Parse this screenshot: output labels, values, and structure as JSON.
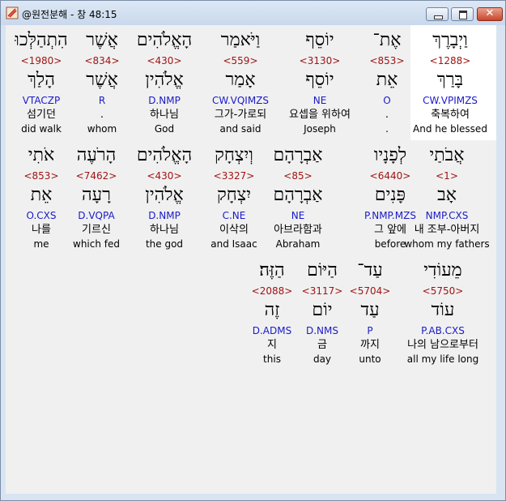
{
  "window": {
    "title": "@원전분해 - 창 48:15",
    "icons": {
      "app": "app-icon",
      "minimize": "minimize-icon",
      "maximize": "maximize-icon",
      "close": "close-icon"
    },
    "close_glyph": "✕"
  },
  "rows": [
    {
      "words": [
        {
          "heb": "וַיְבָרֶךְ",
          "strong": "<1288>",
          "lex": "בָּרַךְ",
          "morph": "CW.VPIMZS",
          "kor": "축복하여",
          "eng": "And he blessed"
        },
        {
          "heb": "אֶת־",
          "strong": "<853>",
          "lex": "אֵת",
          "morph": "O",
          "kor": ".",
          "eng": "."
        },
        {
          "heb": "יוֹסֵף",
          "strong": "<3130>",
          "lex": "יוֹסֵף",
          "morph": "NE",
          "kor": "요셉을 위하여",
          "eng": "Joseph"
        },
        {
          "heb": "וַיֹּאמַר",
          "strong": "<559>",
          "lex": "אָמַר",
          "morph": "CW.VQIMZS",
          "kor": "그가-가로되",
          "eng": "and said"
        },
        {
          "heb": "הָאֱלֹהִים",
          "strong": "<430>",
          "lex": "אֱלֹהִין",
          "morph": "D.NMP",
          "kor": "하나님",
          "eng": "God"
        },
        {
          "heb": "אֲשֶׁר",
          "strong": "<834>",
          "lex": "אֲשֶׁר",
          "morph": "R",
          "kor": ".",
          "eng": "whom"
        },
        {
          "heb": "הִתְהַלְּכוּ",
          "strong": "<1980>",
          "lex": "הָלַךְ",
          "morph": "VTACZP",
          "kor": "섬기던",
          "eng": "did walk"
        }
      ]
    },
    {
      "words": [
        {
          "heb": "אֲבֹתַי",
          "strong": "<1>",
          "lex": "אָב",
          "morph": "NMP.CXS",
          "kor": "내 조부-아버지",
          "eng": "whom my fathers"
        },
        {
          "heb": "לְפָנָיו",
          "strong": "<6440>",
          "lex": "פָּנִים",
          "morph": "P.NMP.MZS",
          "kor": "그 앞에",
          "eng": "before"
        },
        {
          "heb": "אַבְרָהָם",
          "strong": "<85>",
          "lex": "אַבְרָהָם",
          "morph": "NE",
          "kor": "아브라함과",
          "eng": "Abraham"
        },
        {
          "heb": "וְיִצְחָק",
          "strong": "<3327>",
          "lex": "יִצְחָק",
          "morph": "C.NE",
          "kor": "이삭의",
          "eng": "and Isaac"
        },
        {
          "heb": "הָאֱלֹהִים",
          "strong": "<430>",
          "lex": "אֱלֹהִין",
          "morph": "D.NMP",
          "kor": "하나님",
          "eng": "the god"
        },
        {
          "heb": "הָרֹעֶה",
          "strong": "<7462>",
          "lex": "רָעָה",
          "morph": "D.VQPA",
          "kor": "기르신",
          "eng": "which fed"
        },
        {
          "heb": "אֹתִי",
          "strong": "<853>",
          "lex": "אֵת",
          "morph": "O.CXS",
          "kor": "나를",
          "eng": "me"
        }
      ]
    },
    {
      "words": [
        {
          "heb": "מֵעוֹדִי",
          "strong": "<5750>",
          "lex": "עוֹד",
          "morph": "P.AB.CXS",
          "kor": "나의 남으로부터",
          "eng": "all my life long"
        },
        {
          "heb": "עַד־",
          "strong": "<5704>",
          "lex": "עַד",
          "morph": "P",
          "kor": "까지",
          "eng": "unto"
        },
        {
          "heb": "הַיּוֹם",
          "strong": "<3117>",
          "lex": "יוֹם",
          "morph": "D.NMS",
          "kor": "금",
          "eng": "day"
        },
        {
          "heb": "הַזֶּה׃",
          "strong": "<2088>",
          "lex": "זֶה",
          "morph": "D.ADMS",
          "kor": "지",
          "eng": "this"
        }
      ]
    }
  ]
}
